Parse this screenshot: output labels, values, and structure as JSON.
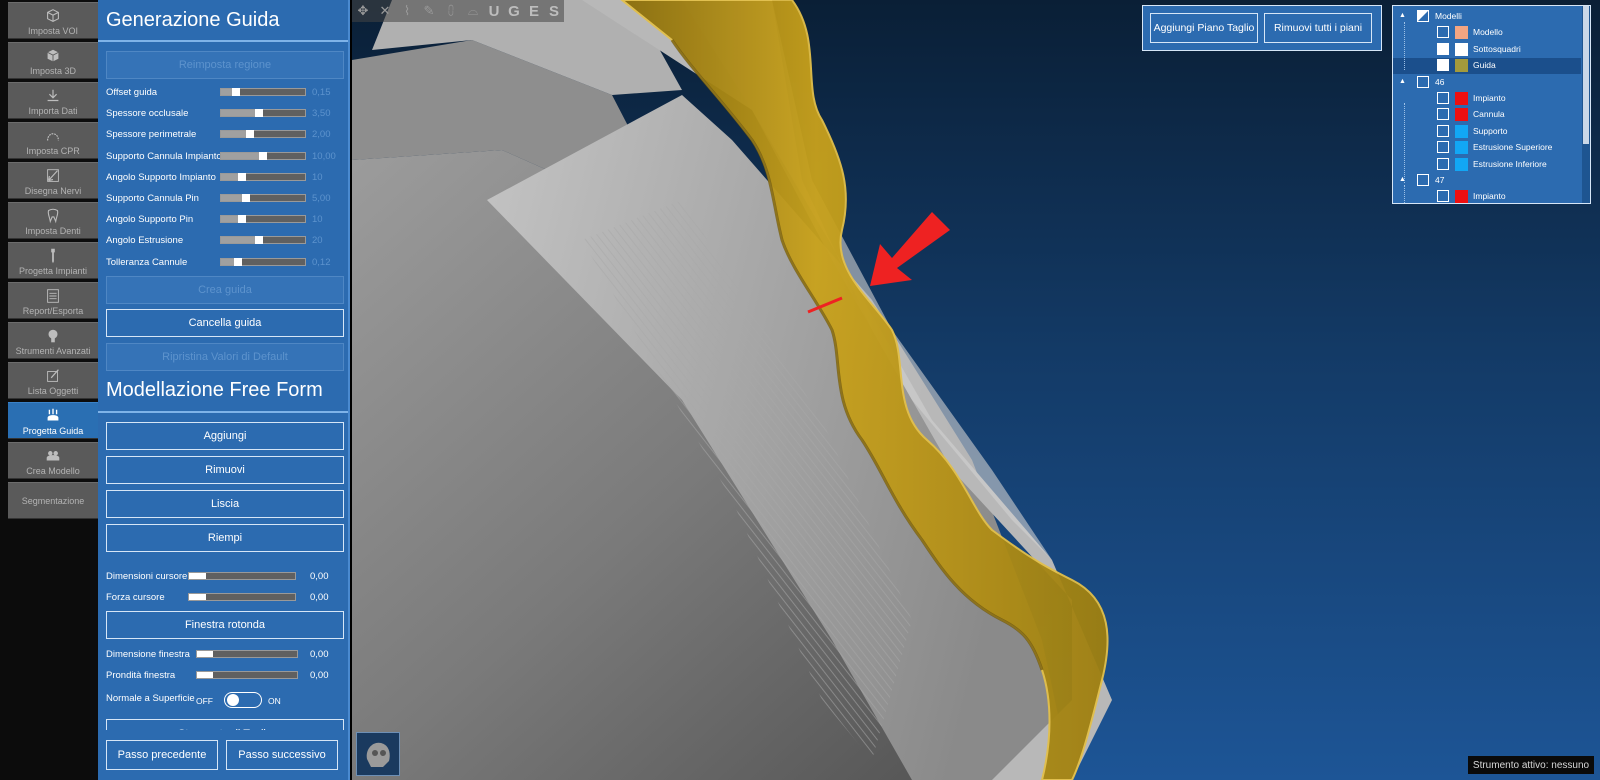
{
  "tools": [
    {
      "label": "Imposta VOI",
      "icon": "cube-outline-icon"
    },
    {
      "label": "Imposta 3D",
      "icon": "cube-3d-icon"
    },
    {
      "label": "Importa Dati",
      "icon": "download-icon"
    },
    {
      "label": "Imposta CPR",
      "icon": "arch-curve-icon"
    },
    {
      "label": "Disegna Nervi",
      "icon": "nerve-draw-icon"
    },
    {
      "label": "Imposta Denti",
      "icon": "tooth-icon"
    },
    {
      "label": "Progetta Impianti",
      "icon": "implant-icon"
    },
    {
      "label": "Report/Esporta",
      "icon": "report-icon"
    },
    {
      "label": "Strumenti Avanzati",
      "icon": "advanced-tools-icon"
    },
    {
      "label": "Lista Oggetti",
      "icon": "object-list-icon"
    },
    {
      "label": "Progetta Guida",
      "icon": "surgical-guide-icon",
      "active": true
    },
    {
      "label": "Crea Modello",
      "icon": "create-model-icon"
    },
    {
      "label": "Segmentazione",
      "icon": ""
    }
  ],
  "guide_generation": {
    "title": "Generazione Guida",
    "reset_region_label": "Reimposta regione",
    "sliders": [
      {
        "label": "Offset guida",
        "value": "0,15",
        "level": 0.18
      },
      {
        "label": "Spessore occlusale",
        "value": "3,50",
        "level": 0.45
      },
      {
        "label": "Spessore perimetrale",
        "value": "2,00",
        "level": 0.35
      },
      {
        "label": "Supporto Cannula Impianto",
        "value": "10,00",
        "level": 0.5
      },
      {
        "label": "Angolo Supporto Impianto",
        "value": "10",
        "level": 0.25
      },
      {
        "label": "Supporto Cannula Pin",
        "value": "5,00",
        "level": 0.3
      },
      {
        "label": "Angolo Supporto Pin",
        "value": "10",
        "level": 0.25
      },
      {
        "label": "Angolo Estrusione",
        "value": "20",
        "level": 0.45
      },
      {
        "label": "Tolleranza Cannule",
        "value": "0,12",
        "level": 0.2
      }
    ],
    "create_label": "Crea guida",
    "delete_label": "Cancella guida",
    "restore_label": "Ripristina Valori di Default"
  },
  "freeform": {
    "title": "Modellazione Free Form",
    "add_label": "Aggiungi",
    "remove_label": "Rimuovi",
    "smooth_label": "Liscia",
    "fill_label": "Riempi",
    "cursor_size_label": "Dimensioni cursore",
    "cursor_size_value": "0,00",
    "cursor_size_level": 0.16,
    "cursor_force_label": "Forza cursore",
    "cursor_force_value": "0,00",
    "cursor_force_level": 0.16,
    "round_window_label": "Finestra rotonda",
    "window_size_label": "Dimensione finestra",
    "window_size_value": "0,00",
    "window_size_level": 0.16,
    "window_depth_label": "Prondità finestra",
    "window_depth_value": "0,00",
    "window_depth_level": 0.16,
    "normal_label": "Normale a Superficie",
    "off_label": "OFF",
    "on_label": "ON",
    "cut_tool_label": "Strumento di Taglio"
  },
  "footer": {
    "prev_label": "Passo precedente",
    "next_label": "Passo successivo"
  },
  "viewport_toolbar": {
    "icons": [
      "move-icon",
      "close-x-icon",
      "implant-tool-icon",
      "pencil-icon",
      "teeth-icon",
      "dental-arch-icon"
    ],
    "letters": [
      "U",
      "G",
      "E",
      "S"
    ]
  },
  "cut_plane": {
    "add_label": "Aggiungi Piano Taglio",
    "remove_label": "Rimuovi tutti i piani"
  },
  "tree": [
    {
      "label": "Modelli",
      "level": 0,
      "expand": "▲",
      "checked": true,
      "color": ""
    },
    {
      "label": "Modello",
      "level": 1,
      "checked": false,
      "color": "#f3a582"
    },
    {
      "label": "Sottosquadri",
      "level": 1,
      "checked": true,
      "color": "#ffffff"
    },
    {
      "label": "Guida",
      "level": 1,
      "checked": true,
      "color": "#a39a3c",
      "selected": true
    },
    {
      "label": "46",
      "level": 0,
      "expand": "▲",
      "checked": false,
      "color": ""
    },
    {
      "label": "Impianto",
      "level": 1,
      "checked": false,
      "color": "#ee0f10"
    },
    {
      "label": "Cannula",
      "level": 1,
      "checked": false,
      "color": "#ee0f10"
    },
    {
      "label": "Supporto",
      "level": 1,
      "checked": false,
      "color": "#12a7f5"
    },
    {
      "label": "Estrusione Superiore",
      "level": 1,
      "checked": false,
      "color": "#12a7f5"
    },
    {
      "label": "Estrusione Inferiore",
      "level": 1,
      "checked": false,
      "color": "#12a7f5"
    },
    {
      "label": "47",
      "level": 0,
      "expand": "▲",
      "checked": false,
      "color": ""
    },
    {
      "label": "Impianto",
      "level": 1,
      "checked": false,
      "color": "#ee0f10"
    }
  ],
  "status": {
    "text": "Strumento attivo: nessuno"
  },
  "colors": {
    "panel_blue": "#2c6bb0",
    "guide_gold": "#c9a21c",
    "arrow_red": "#ee2222"
  }
}
